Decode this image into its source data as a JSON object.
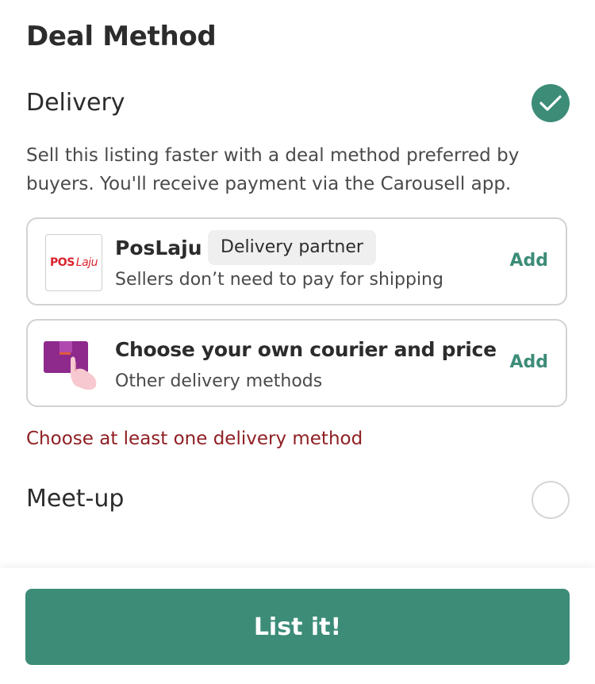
{
  "page": {
    "title": "Deal Method"
  },
  "delivery": {
    "label": "Delivery",
    "selected": true,
    "description": "Sell this listing faster with a deal method preferred by buyers. You'll receive payment via the Carousell app.",
    "options": [
      {
        "logo_text_pos": "POS",
        "logo_text_laju": "Laju",
        "title": "PosLaju",
        "badge": "Delivery partner",
        "subtitle": "Sellers don’t need to pay for shipping",
        "action": "Add"
      },
      {
        "icon": "box-hand-icon",
        "title": "Choose your own courier and price",
        "subtitle": "Other delivery methods",
        "action": "Add"
      }
    ],
    "error": "Choose at least one delivery method"
  },
  "meetup": {
    "label": "Meet-up",
    "selected": false
  },
  "footer": {
    "primary_button": "List it!"
  },
  "colors": {
    "accent": "#3c8c78",
    "error": "#8f1f23",
    "poslaju_red": "#d9232d"
  }
}
